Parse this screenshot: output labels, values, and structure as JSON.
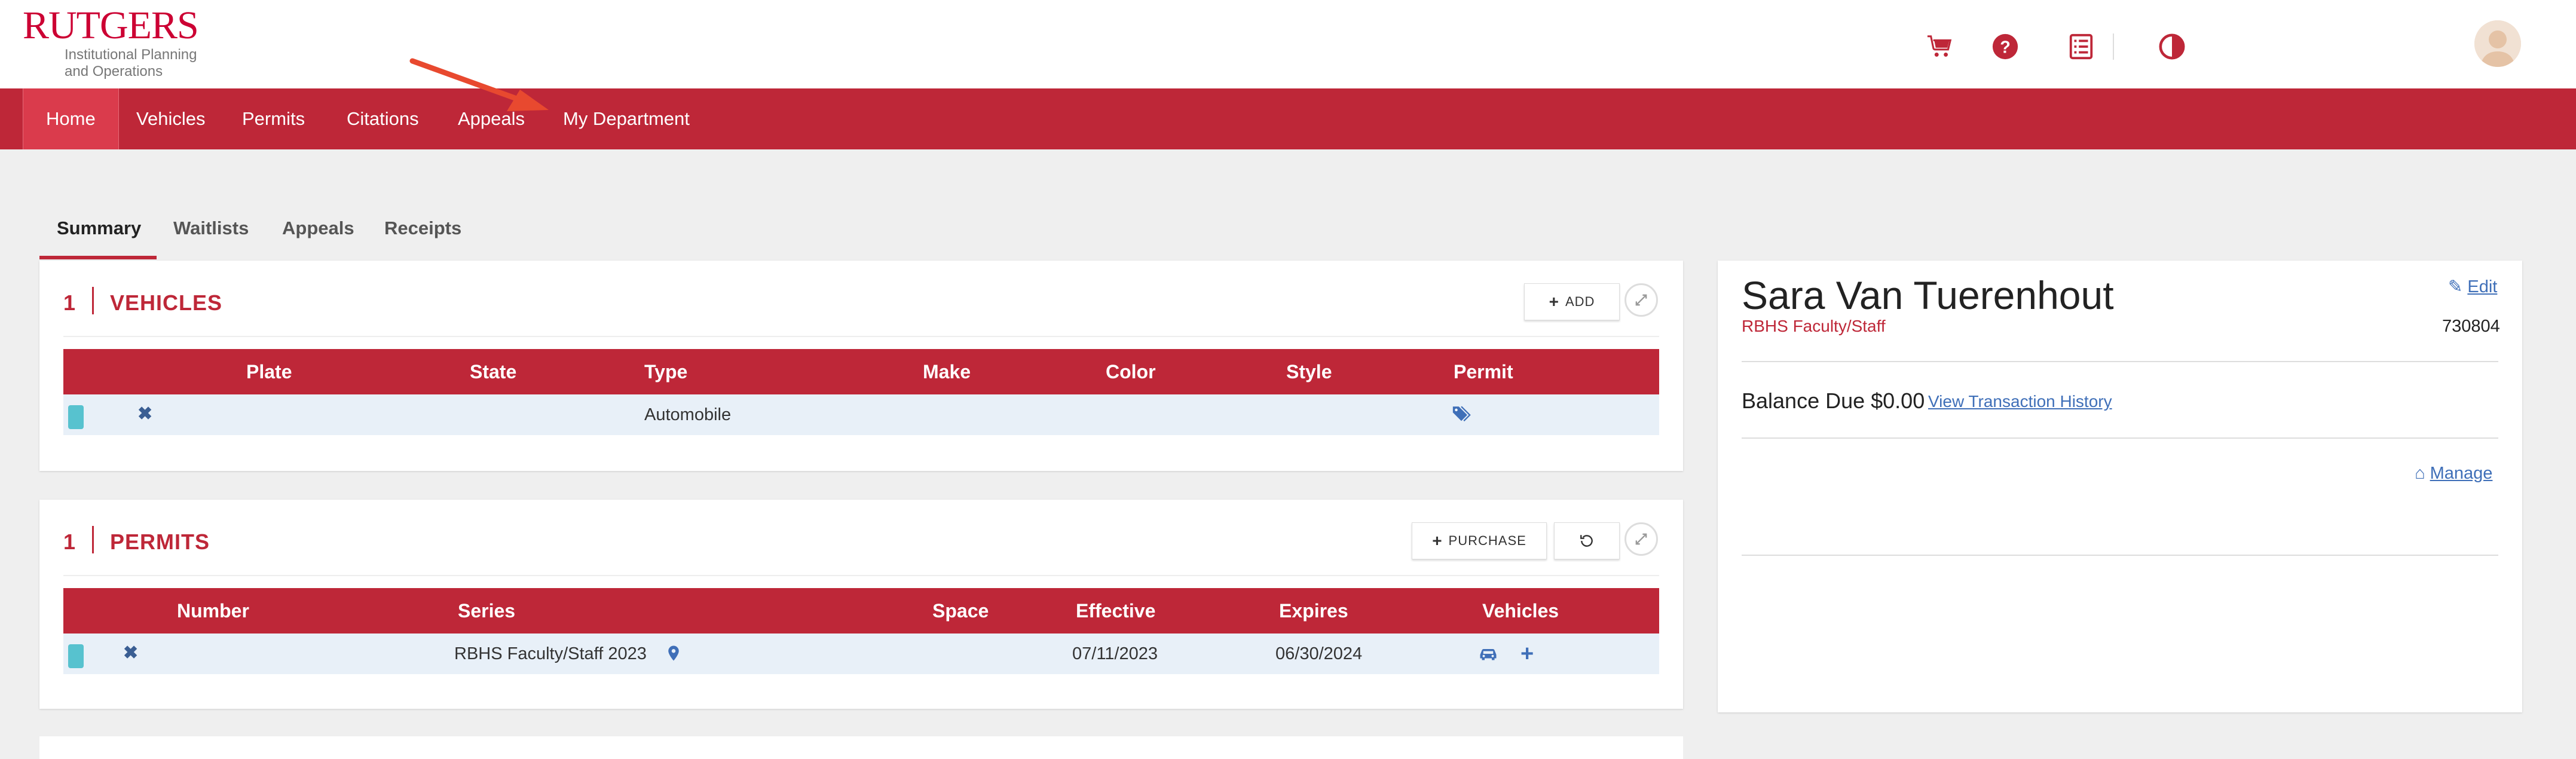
{
  "header": {
    "logo_main": "RUTGERS",
    "logo_sub_line1": "Institutional Planning",
    "logo_sub_line2": "and Operations",
    "icons": [
      "cart-icon",
      "help-icon",
      "receipt-list-icon",
      "contrast-icon"
    ],
    "avatar": "user-avatar"
  },
  "nav": {
    "items": [
      {
        "label": "Home",
        "active": true
      },
      {
        "label": "Vehicles"
      },
      {
        "label": "Permits"
      },
      {
        "label": "Citations"
      },
      {
        "label": "Appeals"
      },
      {
        "label": "My Department"
      }
    ]
  },
  "tabs": [
    {
      "label": "Summary",
      "active": true
    },
    {
      "label": "Waitlists"
    },
    {
      "label": "Appeals"
    },
    {
      "label": "Receipts"
    }
  ],
  "vehicles": {
    "count": "1",
    "title": "VEHICLES",
    "add_label": "ADD",
    "columns": [
      "Plate",
      "State",
      "Type",
      "Make",
      "Color",
      "Style",
      "Permit"
    ],
    "rows": [
      {
        "plate": "",
        "state": "",
        "type": "Automobile",
        "make": "",
        "color": "",
        "style": "",
        "permit_icon": "tag-icon"
      }
    ]
  },
  "permits": {
    "count": "1",
    "title": "PERMITS",
    "purchase_label": "PURCHASE",
    "columns": [
      "Number",
      "Series",
      "Space",
      "Effective",
      "Expires",
      "Vehicles"
    ],
    "rows": [
      {
        "number": "",
        "series": "RBHS Faculty/Staff 2023",
        "space": "",
        "effective": "07/11/2023",
        "expires": "06/30/2024"
      }
    ]
  },
  "profile": {
    "name": "Sara Van Tuerenhout",
    "role": "RBHS Faculty/Staff",
    "id": "730804",
    "edit_label": "Edit",
    "balance_text": "Balance Due $0.00",
    "transaction_link": "View Transaction History",
    "manage_label": "Manage"
  },
  "colors": {
    "brand_red": "#be2738",
    "nav_active": "#da3b4c",
    "link_blue": "#3f6fb8",
    "row_bg": "#e8f0f8",
    "status_teal": "#57c2cf"
  }
}
